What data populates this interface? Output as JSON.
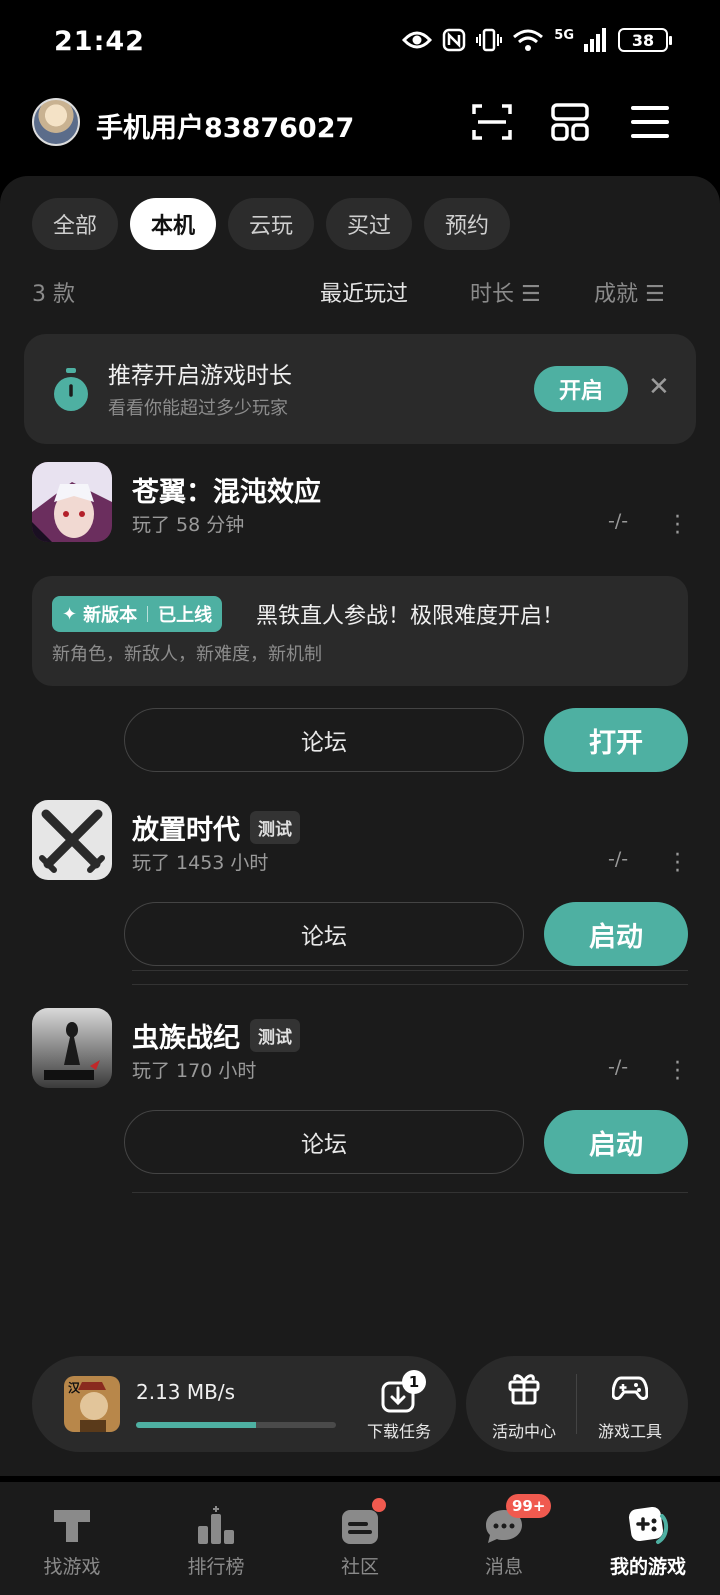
{
  "status": {
    "time": "21:42",
    "network": "5G",
    "battery": "38"
  },
  "header": {
    "username": "手机用户83876027"
  },
  "filters": [
    "全部",
    "本机",
    "云玩",
    "买过",
    "预约"
  ],
  "active_filter": "本机",
  "sort": {
    "count": "3 款",
    "recent": "最近玩过",
    "duration": "时长",
    "achievement": "成就"
  },
  "promo": {
    "title": "推荐开启游戏时长",
    "subtitle": "看看你能超过多少玩家",
    "button": "开启"
  },
  "games": [
    {
      "name": "苍翼：混沌效应",
      "tag": "",
      "playtime": "玩了 58 分钟",
      "score": "-/-",
      "update": {
        "badge": "新版本",
        "badge2": "已上线",
        "title": "黑铁直人参战！极限难度开启！",
        "subtitle": "新角色，新敌人，新难度，新机制"
      },
      "forum": "论坛",
      "action": "打开"
    },
    {
      "name": "放置时代",
      "tag": "测试",
      "playtime": "玩了 1453 小时",
      "score": "-/-",
      "forum": "论坛",
      "action": "启动"
    },
    {
      "name": "虫族战纪",
      "tag": "测试",
      "playtime": "玩了 170 小时",
      "score": "-/-",
      "forum": "论坛",
      "action": "启动"
    }
  ],
  "download": {
    "speed": "2.13 MB/s",
    "progress": 0.6,
    "task_label": "下载任务",
    "task_count": "1"
  },
  "tools": {
    "activity": "活动中心",
    "gametools": "游戏工具"
  },
  "nav": {
    "items": [
      "找游戏",
      "排行榜",
      "社区",
      "消息",
      "我的游戏"
    ],
    "message_badge": "99+"
  },
  "colors": {
    "accent": "#4eb0a2",
    "badge_red": "#f05a4f"
  }
}
